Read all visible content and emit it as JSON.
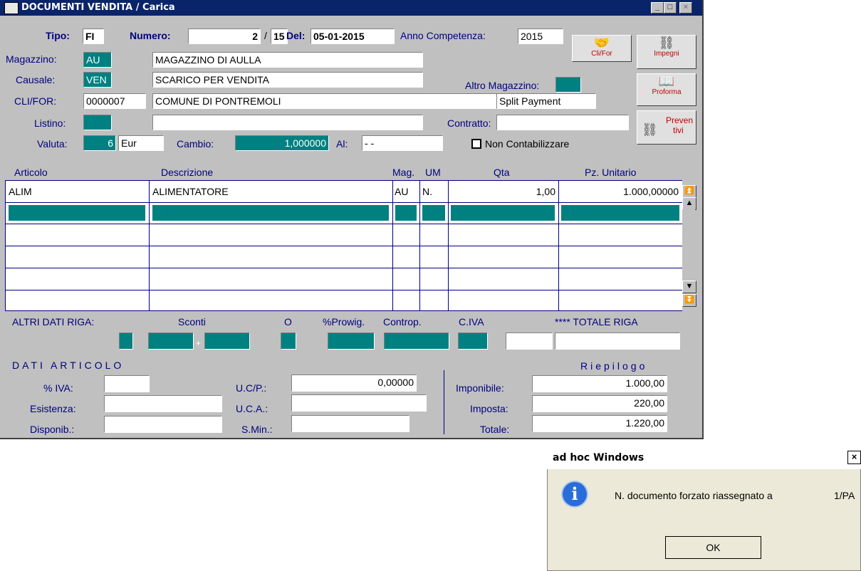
{
  "window": {
    "title": "DOCUMENTI VENDITA / Carica",
    "min_label": "_",
    "max_label": "□",
    "close_label": "×"
  },
  "header": {
    "tipo_label": "Tipo:",
    "tipo_value": "FI",
    "numero_label": "Numero:",
    "numero_value": "2",
    "numero_sep": "/",
    "numero_suffix": "15",
    "del_label": "Del:",
    "del_value": "05-01-2015",
    "anno_label": "Anno Competenza:",
    "anno_value": "2015",
    "magazzino_label": "Magazzino:",
    "magazzino_code": "AU",
    "magazzino_desc": "MAGAZZINO DI AULLA",
    "causale_label": "Causale:",
    "causale_code": "VEN",
    "causale_desc": "SCARICO PER VENDITA",
    "altro_mag_label": "Altro Magazzino:",
    "clifor_label": "CLI/FOR:",
    "clifor_code": "0000007",
    "clifor_desc": "COMUNE DI PONTREMOLI",
    "split_payment": "Split Payment",
    "listino_label": "Listino:",
    "contratto_label": "Contratto:",
    "valuta_label": "Valuta:",
    "valuta_code": "6",
    "valuta_desc": "Eur",
    "cambio_label": "Cambio:",
    "cambio_value": "1,000000",
    "al_label": "Al:",
    "al_value": "- -",
    "non_contab_label": "Non Contabilizzare"
  },
  "side_buttons": {
    "clifor": "Cli/For",
    "impegni": "Impegni",
    "proforma": "Proforma",
    "preventivi_1": "Preven",
    "preventivi_2": "tivi"
  },
  "grid": {
    "headers": [
      "Articolo",
      "Descrizione",
      "Mag.",
      "UM",
      "Qta",
      "Pz. Unitario"
    ],
    "rows": [
      {
        "articolo": "ALIM",
        "descrizione": "ALIMENTATORE",
        "mag": "AU",
        "um": "N.",
        "qta": "1,00",
        "prezzo": "1.000,00000"
      }
    ]
  },
  "riga": {
    "altri_label": "ALTRI DATI RIGA:",
    "sconti_label": "Sconti",
    "o_label": "O",
    "provvig_label": "%Prowig.",
    "controp_label": "Controp.",
    "civa_label": "C.IVA",
    "totale_label": "**** TOTALE RIGA",
    "plus": "+"
  },
  "articolo": {
    "section_label": "DATI ARTICOLO",
    "iva_label": "% IVA:",
    "esistenza_label": "Esistenza:",
    "disponib_label": "Disponib.:",
    "ucp_label": "U.C/P.:",
    "ucp_value": "0,00000",
    "uca_label": "U.C.A.:",
    "smin_label": "S.Min.:"
  },
  "riepilogo": {
    "section_label": "Riepilogo",
    "imponibile_label": "Imponibile:",
    "imponibile_value": "1.000,00",
    "imposta_label": "Imposta:",
    "imposta_value": "220,00",
    "totale_label": "Totale:",
    "totale_value": "1.220,00"
  },
  "dialog": {
    "title": "ad hoc Windows",
    "message": "N. documento forzato riassegnato a",
    "message_value": "1/PA",
    "ok_label": "OK",
    "close_label": "×"
  },
  "colors": {
    "titlebar": "#0a246a",
    "teal": "#008080",
    "label": "#000080",
    "window_bg": "#c0c0c0"
  }
}
